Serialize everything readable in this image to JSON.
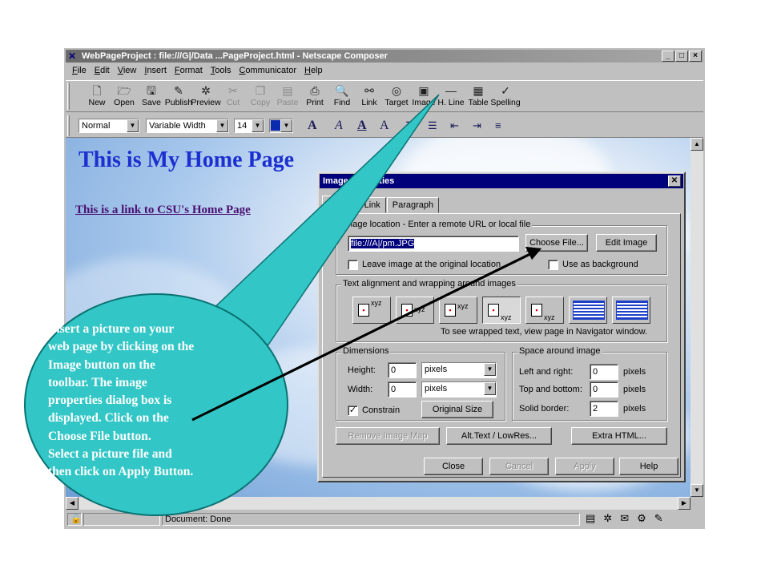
{
  "window": {
    "title": "WebPageProject : file:///G|/Data ...PageProject.html - Netscape Composer",
    "controls": [
      "_",
      "□",
      "×"
    ]
  },
  "menu": [
    "File",
    "Edit",
    "View",
    "Insert",
    "Format",
    "Tools",
    "Communicator",
    "Help"
  ],
  "toolbar": [
    {
      "label": "New",
      "icon": "new-document-icon",
      "glyph": "🗋",
      "enabled": true
    },
    {
      "label": "Open",
      "icon": "open-icon",
      "glyph": "🗁",
      "enabled": true
    },
    {
      "label": "Save",
      "icon": "save-icon",
      "glyph": "🖫",
      "enabled": true
    },
    {
      "label": "Publish",
      "icon": "publish-icon",
      "glyph": "✎",
      "enabled": true
    },
    {
      "label": "Preview",
      "icon": "preview-icon",
      "glyph": "✲",
      "enabled": true
    },
    {
      "label": "Cut",
      "icon": "cut-icon",
      "glyph": "✂",
      "enabled": false
    },
    {
      "label": "Copy",
      "icon": "copy-icon",
      "glyph": "❐",
      "enabled": false
    },
    {
      "label": "Paste",
      "icon": "paste-icon",
      "glyph": "▤",
      "enabled": false
    },
    {
      "label": "Print",
      "icon": "print-icon",
      "glyph": "⎙",
      "enabled": true
    },
    {
      "label": "Find",
      "icon": "find-icon",
      "glyph": "🔍",
      "enabled": true
    },
    {
      "label": "Link",
      "icon": "link-icon",
      "glyph": "⚯",
      "enabled": true
    },
    {
      "label": "Target",
      "icon": "target-icon",
      "glyph": "◎",
      "enabled": true
    },
    {
      "label": "Image",
      "icon": "image-icon",
      "glyph": "▣",
      "enabled": true
    },
    {
      "label": "H. Line",
      "icon": "horizontal-line-icon",
      "glyph": "—",
      "enabled": true
    },
    {
      "label": "Table",
      "icon": "table-icon",
      "glyph": "▦",
      "enabled": true
    },
    {
      "label": "Spelling",
      "icon": "spelling-icon",
      "glyph": "✓",
      "enabled": true
    }
  ],
  "format": {
    "style": "Normal",
    "font": "Variable Width",
    "size": "14",
    "color": "#0a2bb0"
  },
  "page": {
    "heading": "This is My Home Page",
    "link": "This is a link to CSU's Home Page"
  },
  "dialog": {
    "title": "Image Properties",
    "tabs": [
      "Image",
      "Link",
      "Paragraph"
    ],
    "location_group": "Image location - Enter a remote URL or local file",
    "file_value": "file:///A|/pm.JPG",
    "choose_file": "Choose File...",
    "edit_image": "Edit Image",
    "leave_image": "Leave image at the original location",
    "use_background": "Use as background",
    "align_group": "Text alignment and wrapping around images",
    "align_note": "To see wrapped text, view page in Navigator window.",
    "align_xyz": "xyz",
    "dimensions_group": "Dimensions",
    "height_label": "Height:",
    "height_value": "0",
    "width_label": "Width:",
    "width_value": "0",
    "unit": "pixels",
    "constrain": "Constrain",
    "original_size": "Original Size",
    "space_group": "Space around image",
    "left_right_label": "Left and right:",
    "left_right_value": "0",
    "top_bottom_label": "Top and bottom:",
    "top_bottom_value": "0",
    "border_label": "Solid border:",
    "border_value": "2",
    "remove_map": "Remove Image Map",
    "alt_text": "Alt.Text / LowRes...",
    "extra_html": "Extra HTML...",
    "close": "Close",
    "cancel": "Cancel",
    "apply": "Apply",
    "help": "Help"
  },
  "status": {
    "text": "Document: Done"
  },
  "callout": {
    "lines": [
      "Insert a picture on your",
      "web page by clicking on the",
      "Image button on the",
      "toolbar.  The image",
      "properties dialog box is",
      "displayed.  Click on the",
      "Choose File button.",
      "Select a picture file and",
      "then click on Apply Button."
    ]
  }
}
